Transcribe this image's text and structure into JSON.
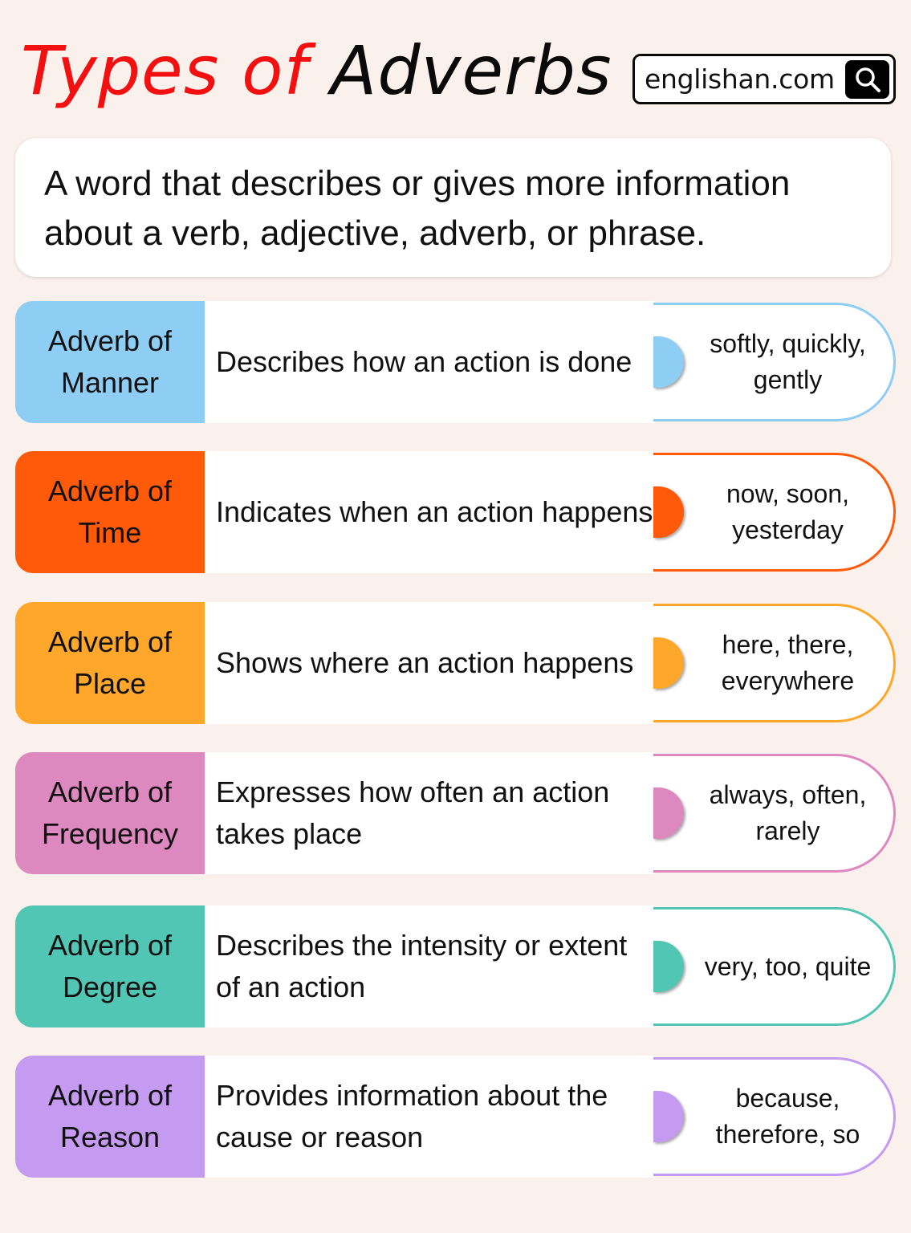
{
  "header": {
    "title_part1": "Types of",
    "title_part2": "Adverbs",
    "title_colors": {
      "part1": "#f21010",
      "part2": "#0a0a0a"
    },
    "brand": {
      "text": "englishan.com",
      "icon": "search-icon"
    }
  },
  "definition": {
    "text": "A word that describes or gives more information about a verb, adjective, adverb, or phrase."
  },
  "types": [
    {
      "name": "Adverb of Manner",
      "name_line1": "Adverb of",
      "name_line2": "Manner",
      "description": "Describes how an action is done",
      "examples": "softly, quickly, gently",
      "color": "#8ecdf4"
    },
    {
      "name": "Adverb of Time",
      "name_line1": "Adverb of",
      "name_line2": "Time",
      "description": "Indicates when an action happens",
      "examples": "now, soon, yesterday",
      "color": "#fe5a0a"
    },
    {
      "name": "Adverb of Place",
      "name_line1": "Adverb of",
      "name_line2": "Place",
      "description": "Shows where an action happens",
      "examples": "here, there, everywhere",
      "color": "#fea72a"
    },
    {
      "name": "Adverb of Frequency",
      "name_line1": "Adverb of",
      "name_line2": "Frequency",
      "description": "Expresses how often an action takes place",
      "examples": "always, often, rarely",
      "color": "#dd88bf"
    },
    {
      "name": "Adverb of Degree",
      "name_line1": "Adverb of",
      "name_line2": "Degree",
      "description": "Describes the intensity or extent of an action",
      "examples": "very, too, quite",
      "color": "#52c6b4"
    },
    {
      "name": "Adverb of Reason",
      "name_line1": "Adverb of",
      "name_line2": "Reason",
      "description": "Provides information about the cause or reason",
      "examples": "because, therefore, so",
      "color": "#c59bf2"
    }
  ]
}
